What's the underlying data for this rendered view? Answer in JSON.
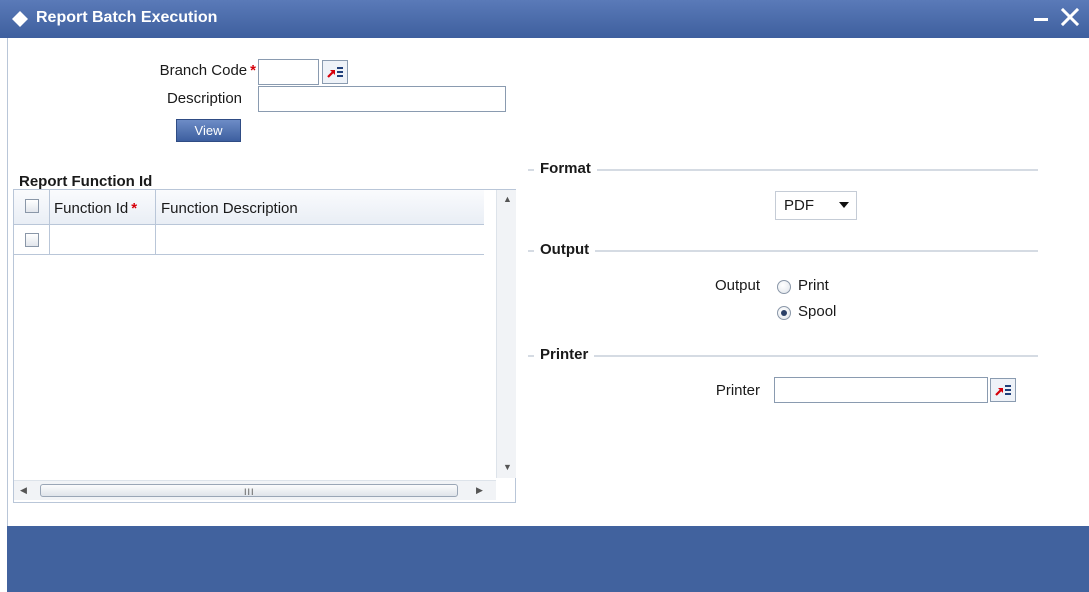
{
  "window": {
    "title": "Report Batch Execution",
    "minimize_icon": "minimize-icon",
    "close_icon": "close-icon"
  },
  "header_form": {
    "branch_code_label": "Branch Code",
    "branch_code_value": "",
    "description_label": "Description",
    "description_value": "",
    "required_marker": "*",
    "view_button": "View",
    "lov_icon": "list-of-values-icon"
  },
  "report_function": {
    "title": "Report Function Id",
    "toolbar": {
      "add_icon": "plus-icon",
      "delete_icon": "minus-icon",
      "view_icon": "list-view-icon"
    },
    "columns": [
      {
        "label": "Function Id",
        "required": "*"
      },
      {
        "label": "Function Description"
      }
    ],
    "rows": [
      {
        "function_id": "",
        "function_description": ""
      }
    ],
    "scroll_grip": "III"
  },
  "format": {
    "legend": "Format",
    "selected": "PDF"
  },
  "output": {
    "legend": "Output",
    "label": "Output",
    "options": [
      {
        "label": "Print",
        "selected": false
      },
      {
        "label": "Spool",
        "selected": true
      }
    ]
  },
  "printer": {
    "legend": "Printer",
    "label": "Printer",
    "value": ""
  },
  "colors": {
    "titlebar": "#3e5f9e",
    "footer": "#41629e",
    "required": "#d6000a"
  }
}
